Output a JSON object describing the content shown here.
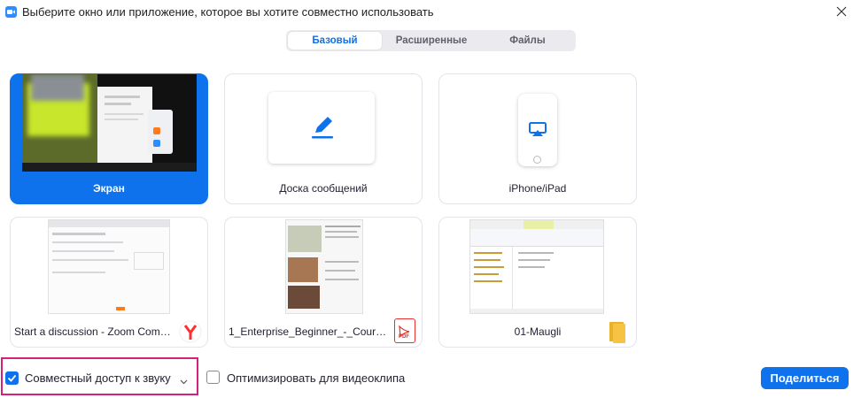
{
  "window": {
    "title": "Выберите окно или приложение, которое вы хотите совместно использовать",
    "app_icon": "zoom-camera-icon",
    "close_icon": "close-icon"
  },
  "tabs": [
    {
      "label": "Базовый",
      "active": true
    },
    {
      "label": "Расширенные",
      "active": false
    },
    {
      "label": "Файлы",
      "active": false
    }
  ],
  "tiles": [
    {
      "label": "Экран",
      "selected": true,
      "kind": "screen"
    },
    {
      "label": "Доска сообщений",
      "selected": false,
      "kind": "whiteboard",
      "icon": "pencil-icon"
    },
    {
      "label": "iPhone/iPad",
      "selected": false,
      "kind": "device",
      "icon": "airplay-icon"
    },
    {
      "label": "Start a discussion - Zoom Comm...",
      "selected": false,
      "kind": "window",
      "app_icon": "yandex-browser-icon"
    },
    {
      "label": "1_Enterprise_Beginner_-_Courseb...",
      "selected": false,
      "kind": "window",
      "app_icon": "pdf-icon",
      "app_icon_text": "PDF"
    },
    {
      "label": "01-Maugli",
      "selected": false,
      "kind": "window",
      "app_icon": "folder-icon"
    }
  ],
  "options": {
    "share_audio": {
      "label": "Совместный доступ к звуку",
      "checked": true
    },
    "optimize_video": {
      "label": "Оптимизировать для видеоклипа",
      "checked": false
    }
  },
  "share_button": {
    "label": "Поделиться"
  },
  "colors": {
    "accent": "#0e72ed",
    "highlight": "#d4217c",
    "pdf_red": "#e4322b",
    "yandex_red": "#ff2e2e",
    "folder_yellow": "#f6c343"
  }
}
